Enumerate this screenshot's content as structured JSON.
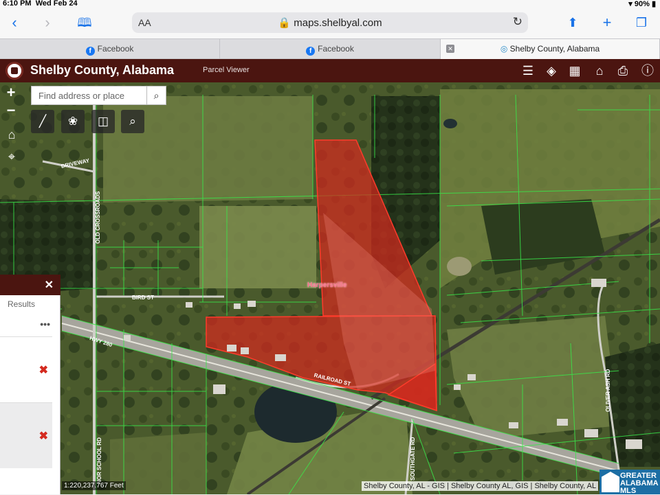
{
  "status_bar": {
    "time": "6:10 PM",
    "date": "Wed Feb 24",
    "battery": "90%"
  },
  "browser": {
    "aa_label": "AA",
    "url": "maps.shelbyal.com",
    "tabs": [
      {
        "label": "Facebook"
      },
      {
        "label": "Facebook"
      },
      {
        "label": "Shelby County, Alabama"
      }
    ]
  },
  "app": {
    "title": "Shelby County, Alabama",
    "subtitle": "Parcel Viewer",
    "header_color": "#4b1510"
  },
  "search": {
    "placeholder": "Find address or place"
  },
  "map": {
    "place_label": "Harpersville",
    "road_labels": [
      "DRIVEWAY",
      "BIRD ST",
      "HWY 280",
      "RAILROAD ST",
      "OLD CROSSROADS",
      "NOR SCHOOL RD",
      "OLIVER ASH RD",
      "SOUTHGATE RD"
    ],
    "parcel_highlight_color": "#d42a1f",
    "parcel_line_color": "#39e84a"
  },
  "results_panel": {
    "label": "Results",
    "more_label": "•••",
    "row_count": 2
  },
  "footer": {
    "scale_text": "1:220,237.767 Feet",
    "attribution": "Shelby County, AL - GIS | Shelby County AL, GIS | Shelby County, AL",
    "mls_line1": "GREATER",
    "mls_line2": "ALABAMA",
    "mls_line3": "MLS"
  }
}
